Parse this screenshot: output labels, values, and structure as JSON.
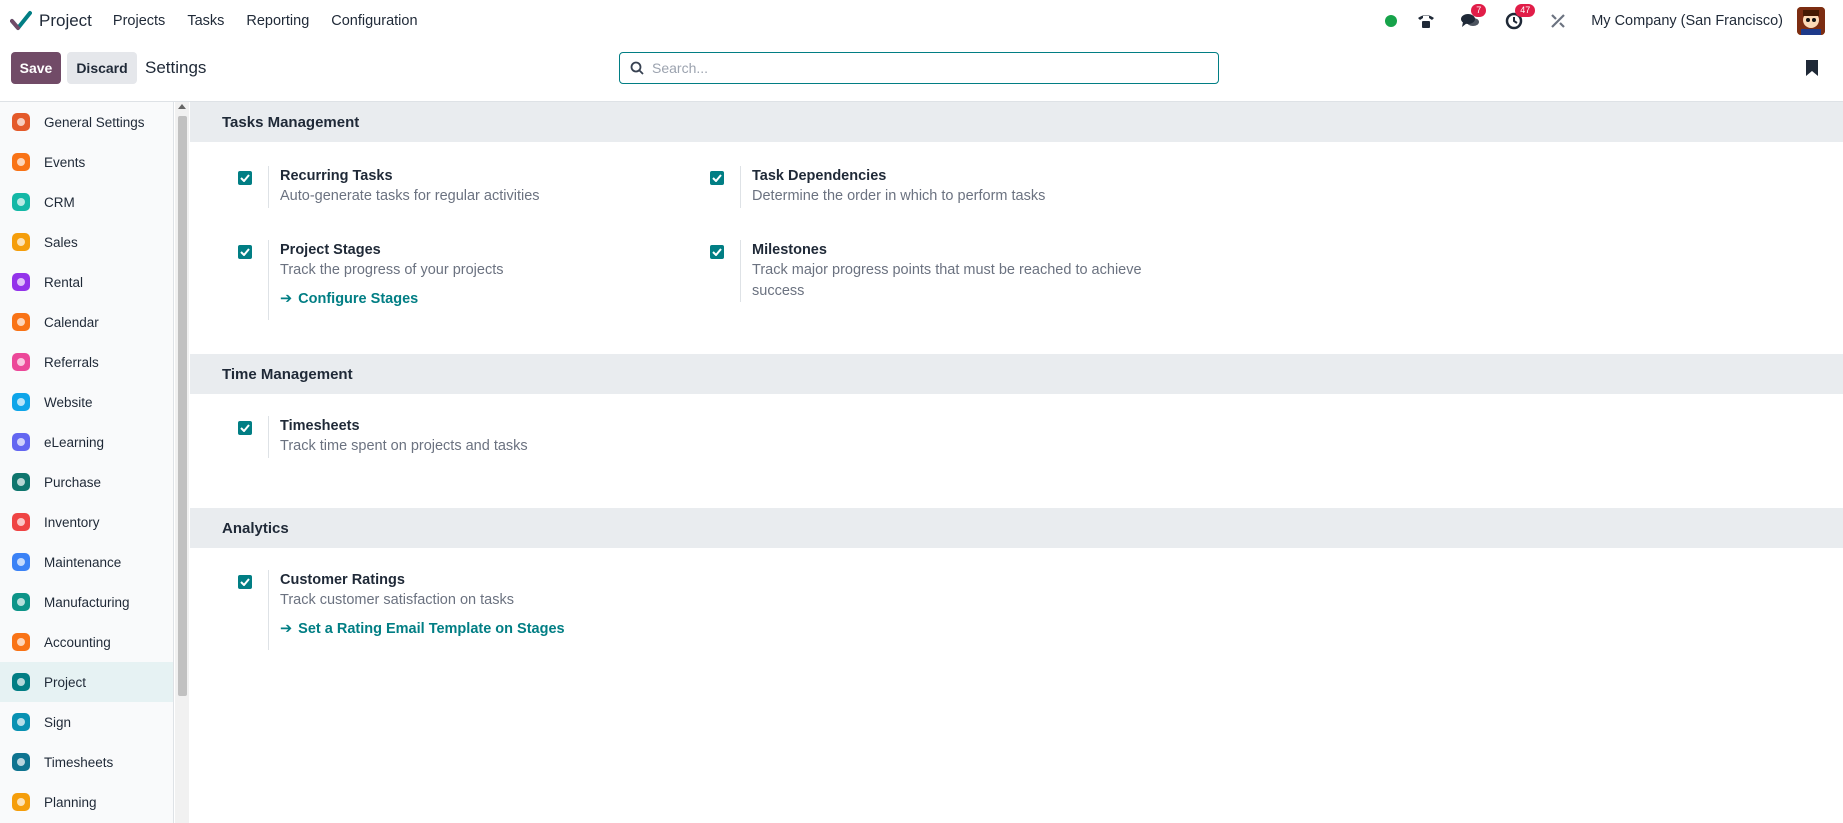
{
  "app": {
    "name": "Project"
  },
  "menu": [
    "Projects",
    "Tasks",
    "Reporting",
    "Configuration"
  ],
  "navbar": {
    "messages_badge": "7",
    "activities_badge": "47",
    "company": "My Company (San Francisco)"
  },
  "control_panel": {
    "save_label": "Save",
    "discard_label": "Discard",
    "title": "Settings",
    "search_placeholder": "Search..."
  },
  "sidebar": {
    "items": [
      {
        "label": "General Settings",
        "icon": "general-settings-icon",
        "color": "#e45a2a"
      },
      {
        "label": "Events",
        "icon": "events-icon",
        "color": "#f97316"
      },
      {
        "label": "CRM",
        "icon": "crm-icon",
        "color": "#14b8a6"
      },
      {
        "label": "Sales",
        "icon": "sales-icon",
        "color": "#f59e0b"
      },
      {
        "label": "Rental",
        "icon": "rental-icon",
        "color": "#9333ea"
      },
      {
        "label": "Calendar",
        "icon": "calendar-icon",
        "color": "#f97316"
      },
      {
        "label": "Referrals",
        "icon": "referrals-icon",
        "color": "#ec4899"
      },
      {
        "label": "Website",
        "icon": "website-icon",
        "color": "#0ea5e9"
      },
      {
        "label": "eLearning",
        "icon": "elearning-icon",
        "color": "#6366f1"
      },
      {
        "label": "Purchase",
        "icon": "purchase-icon",
        "color": "#0f766e"
      },
      {
        "label": "Inventory",
        "icon": "inventory-icon",
        "color": "#ef4444"
      },
      {
        "label": "Maintenance",
        "icon": "maintenance-icon",
        "color": "#3b82f6"
      },
      {
        "label": "Manufacturing",
        "icon": "manufacturing-icon",
        "color": "#0d9488"
      },
      {
        "label": "Accounting",
        "icon": "accounting-icon",
        "color": "#f97316"
      },
      {
        "label": "Project",
        "icon": "project-icon",
        "color": "#017e84",
        "active": true
      },
      {
        "label": "Sign",
        "icon": "sign-icon",
        "color": "#0891b2"
      },
      {
        "label": "Timesheets",
        "icon": "timesheets-icon",
        "color": "#0e7490"
      },
      {
        "label": "Planning",
        "icon": "planning-icon",
        "color": "#f59e0b"
      }
    ]
  },
  "sections": {
    "tasks": {
      "title": "Tasks Management",
      "recurring": {
        "title": "Recurring Tasks",
        "desc": "Auto-generate tasks for regular activities"
      },
      "dependencies": {
        "title": "Task Dependencies",
        "desc": "Determine the order in which to perform tasks"
      },
      "stages": {
        "title": "Project Stages",
        "desc": "Track the progress of your projects",
        "link": "Configure Stages"
      },
      "milestones": {
        "title": "Milestones",
        "desc": "Track major progress points that must be reached to achieve success"
      }
    },
    "time": {
      "title": "Time Management",
      "timesheets": {
        "title": "Timesheets",
        "desc": "Track time spent on projects and tasks"
      }
    },
    "analytics": {
      "title": "Analytics",
      "ratings": {
        "title": "Customer Ratings",
        "desc": "Track customer satisfaction on tasks",
        "link": "Set a Rating Email Template on Stages"
      }
    }
  },
  "colors": {
    "brand": "#714b67",
    "accent": "#017e84"
  }
}
